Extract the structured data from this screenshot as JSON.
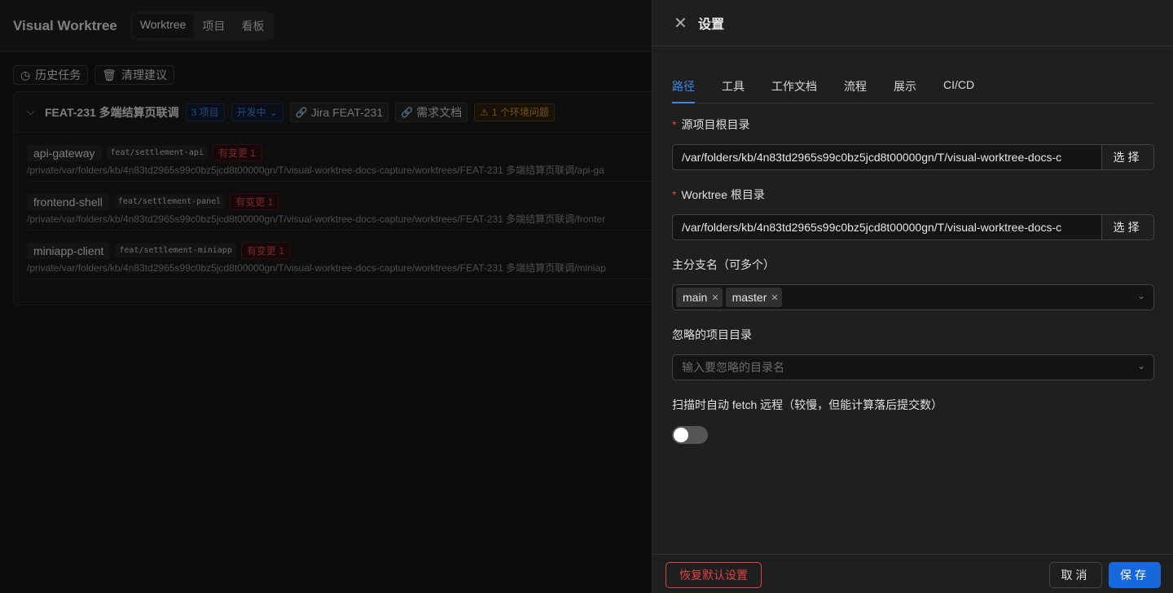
{
  "app": {
    "title": "Visual Worktree"
  },
  "nav": {
    "tabs": [
      "Worktree",
      "项目",
      "看板"
    ]
  },
  "toolbar": {
    "history": "历史任务",
    "cleanup": "清理建议"
  },
  "feature": {
    "title": "FEAT-231 多端结算页联调",
    "count": "3 项目",
    "status": "开发中",
    "jira": "Jira FEAT-231",
    "doc": "需求文档",
    "warning": "1 个环境问题"
  },
  "worktrees": [
    {
      "repo": "api-gateway",
      "branch": "feat/settlement-api",
      "changes": "有变更 1",
      "path": "/private/var/folders/kb/4n83td2965s99c0bz5jcd8t00000gn/T/visual-worktree-docs-capture/worktrees/FEAT-231 多端结算页联调/api-ga"
    },
    {
      "repo": "frontend-shell",
      "branch": "feat/settlement-panel",
      "changes": "有变更 1",
      "path": "/private/var/folders/kb/4n83td2965s99c0bz5jcd8t00000gn/T/visual-worktree-docs-capture/worktrees/FEAT-231 多端结算页联调/fronter"
    },
    {
      "repo": "miniapp-client",
      "branch": "feat/settlement-miniapp",
      "changes": "有变更 1",
      "path": "/private/var/folders/kb/4n83td2965s99c0bz5jcd8t00000gn/T/visual-worktree-docs-capture/worktrees/FEAT-231 多端结算页联调/miniap"
    }
  ],
  "drawer": {
    "title": "设置",
    "tabs": [
      "路径",
      "工具",
      "工作文档",
      "流程",
      "展示",
      "CI/CD"
    ],
    "source_root": {
      "label": "源项目根目录",
      "value": "/var/folders/kb/4n83td2965s99c0bz5jcd8t00000gn/T/visual-worktree-docs-c",
      "button": "选择"
    },
    "worktree_root": {
      "label": "Worktree 根目录",
      "value": "/var/folders/kb/4n83td2965s99c0bz5jcd8t00000gn/T/visual-worktree-docs-c",
      "button": "选择"
    },
    "main_branches": {
      "label": "主分支名（可多个）",
      "values": [
        "main",
        "master"
      ]
    },
    "ignored_dirs": {
      "label": "忽略的项目目录",
      "placeholder": "输入要忽略的目录名"
    },
    "auto_fetch": {
      "label": "扫描时自动 fetch 远程（较慢，但能计算落后提交数）",
      "enabled": false
    },
    "footer": {
      "reset": "恢复默认设置",
      "cancel": "取消",
      "save": "保存"
    }
  },
  "colors": {
    "accent": "#1668dc",
    "danger": "#dc4446",
    "warning": "#d89614"
  }
}
